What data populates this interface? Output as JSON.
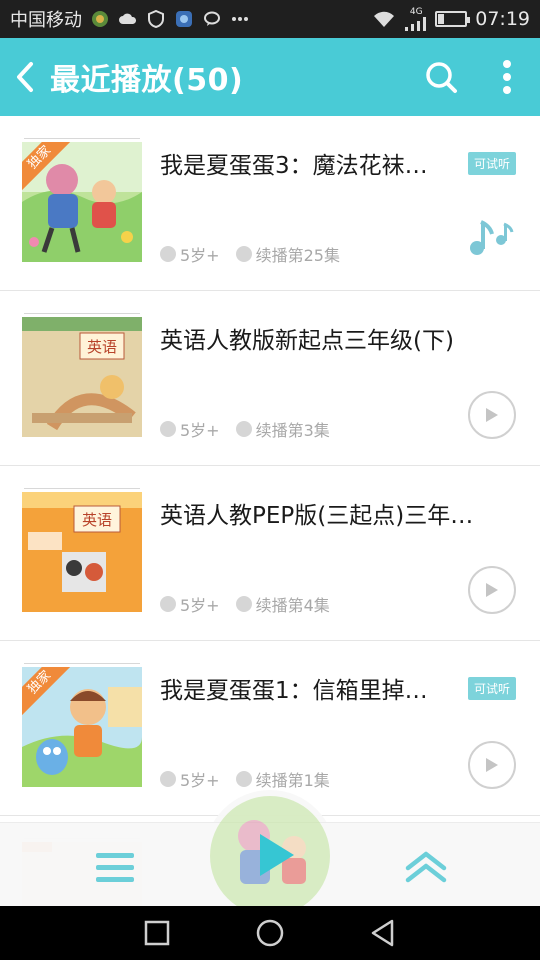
{
  "status_bar": {
    "carrier": "中国移动",
    "network": "4G",
    "time": "07:19"
  },
  "app_bar": {
    "title": "最近播放(50)",
    "icons": [
      "back-icon",
      "search-icon",
      "more-vert-icon"
    ]
  },
  "list": [
    {
      "title": "我是夏蛋蛋3：魔法花袜…",
      "exclusive": true,
      "exclusive_label": "独家",
      "trial": "可试听",
      "age": "5岁+",
      "progress": "续播第25集",
      "state": "playing"
    },
    {
      "title": "英语人教版新起点三年级(下)",
      "exclusive": false,
      "trial": "",
      "age": "5岁+",
      "progress": "续播第3集",
      "state": "paused",
      "cover_text": "英语"
    },
    {
      "title": "英语人教PEP版(三起点)三年…",
      "exclusive": false,
      "trial": "",
      "age": "5岁+",
      "progress": "续播第4集",
      "state": "paused",
      "cover_text": "英语"
    },
    {
      "title": "我是夏蛋蛋1：信箱里掉…",
      "exclusive": true,
      "exclusive_label": "独家",
      "trial": "可试听",
      "age": "5岁+",
      "progress": "续播第1集",
      "state": "paused"
    }
  ],
  "colors": {
    "accent": "#49cbd6",
    "trial_badge": "#7dd3db",
    "exclusive_tag": "#f08a3a"
  }
}
